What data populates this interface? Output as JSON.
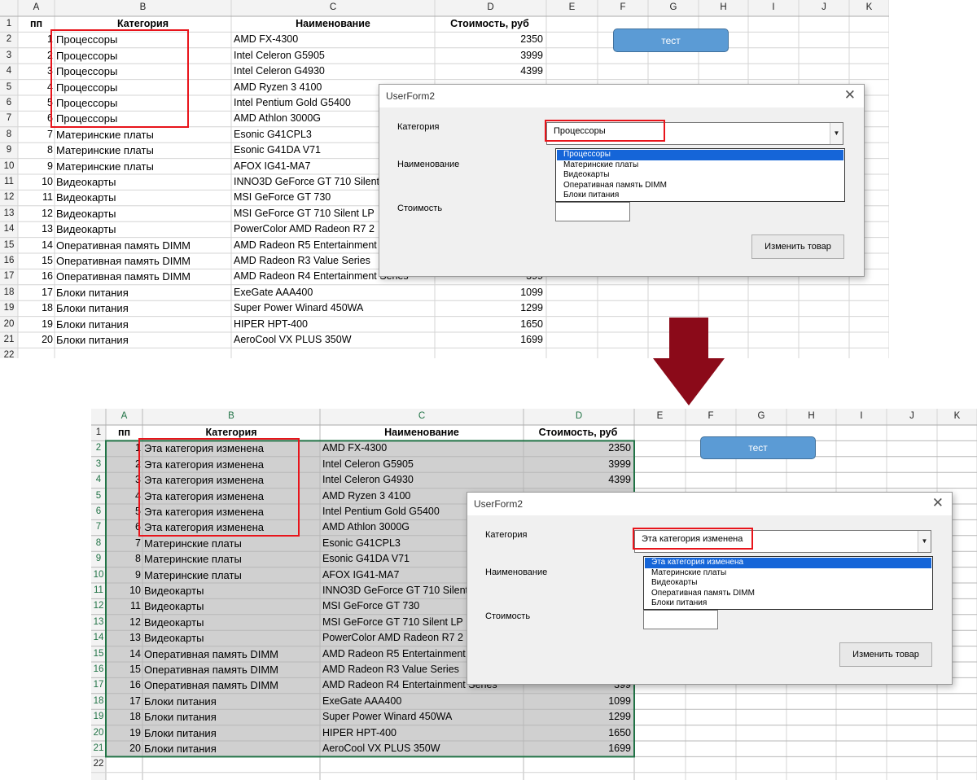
{
  "columns": [
    "A",
    "B",
    "C",
    "D",
    "E",
    "F",
    "G",
    "H",
    "I",
    "J",
    "K"
  ],
  "rows": [
    {
      "n": "1",
      "pp": "пп",
      "cat": "Категория",
      "name": "Наименование",
      "cost": "Стоимость, руб"
    },
    {
      "n": "2",
      "pp": "1",
      "cat": "Процессоры",
      "name": "AMD FX-4300",
      "cost": "2350"
    },
    {
      "n": "3",
      "pp": "2",
      "cat": "Процессоры",
      "name": "Intel Celeron G5905",
      "cost": "3999"
    },
    {
      "n": "4",
      "pp": "3",
      "cat": "Процессоры",
      "name": "Intel Celeron G4930",
      "cost": "4399"
    },
    {
      "n": "5",
      "pp": "4",
      "cat": "Процессоры",
      "name": "AMD Ryzen 3 4100",
      "cost": ""
    },
    {
      "n": "6",
      "pp": "5",
      "cat": "Процессоры",
      "name": "Intel Pentium Gold G5400",
      "cost": ""
    },
    {
      "n": "7",
      "pp": "6",
      "cat": "Процессоры",
      "name": "AMD Athlon 3000G",
      "cost": ""
    },
    {
      "n": "8",
      "pp": "7",
      "cat": "Материнские платы",
      "name": "Esonic G41CPL3",
      "cost": ""
    },
    {
      "n": "9",
      "pp": "8",
      "cat": "Материнские платы",
      "name": "Esonic G41DA V71",
      "cost": ""
    },
    {
      "n": "10",
      "pp": "9",
      "cat": "Материнские платы",
      "name": "AFOX IG41-MA7",
      "cost": ""
    },
    {
      "n": "11",
      "pp": "10",
      "cat": "Видеокарты",
      "name": "INNO3D GeForce GT 710 Silent",
      "cost": ""
    },
    {
      "n": "12",
      "pp": "11",
      "cat": "Видеокарты",
      "name": "MSI GeForce GT 730",
      "cost": ""
    },
    {
      "n": "13",
      "pp": "12",
      "cat": "Видеокарты",
      "name": "MSI GeForce GT 710 Silent LP",
      "cost": ""
    },
    {
      "n": "14",
      "pp": "13",
      "cat": "Видеокарты",
      "name": "PowerColor AMD Radeon R7 2",
      "cost": ""
    },
    {
      "n": "15",
      "pp": "14",
      "cat": "Оперативная память DIMM",
      "name": "AMD Radeon R5 Entertainment",
      "cost": ""
    },
    {
      "n": "16",
      "pp": "15",
      "cat": "Оперативная память DIMM",
      "name": "AMD Radeon R3 Value Series",
      "cost": ""
    },
    {
      "n": "17",
      "pp": "16",
      "cat": "Оперативная память DIMM",
      "name": "AMD Radeon R4 Entertainment Series",
      "cost": "399"
    },
    {
      "n": "18",
      "pp": "17",
      "cat": "Блоки питания",
      "name": "ExeGate AAA400",
      "cost": "1099"
    },
    {
      "n": "19",
      "pp": "18",
      "cat": "Блоки питания",
      "name": "Super Power Winard 450WA",
      "cost": "1299"
    },
    {
      "n": "20",
      "pp": "19",
      "cat": "Блоки питания",
      "name": "HIPER HPT-400",
      "cost": "1650"
    },
    {
      "n": "21",
      "pp": "20",
      "cat": "Блоки питания",
      "name": "AeroCool VX PLUS 350W",
      "cost": "1699"
    },
    {
      "n": "22",
      "pp": "",
      "cat": "",
      "name": "",
      "cost": ""
    }
  ],
  "changed_category": "Эта категория изменена",
  "test_button": "тест",
  "form": {
    "title": "UserForm2",
    "close": "✕",
    "label_category": "Категория",
    "label_name": "Наименование",
    "label_cost": "Стоимость",
    "change_button": "Изменить товар",
    "combo_value_before": "Процессоры",
    "combo_value_after": "Эта категория изменена",
    "options_before": [
      "Процессоры",
      "Материнские платы",
      "Видеокарты",
      "Оперативная память DIMM",
      "Блоки питания"
    ],
    "options_after": [
      "Эта категория изменена",
      "Материнские платы",
      "Видеокарты",
      "Оперативная память DIMM",
      "Блоки питания"
    ]
  },
  "colors": {
    "accent": "#5b9bd5",
    "highlight": "#e8141b",
    "arrow": "#8b0a19",
    "selection": "#1565d8",
    "range_fill": "#d0d0d0",
    "range_border": "#217346"
  }
}
